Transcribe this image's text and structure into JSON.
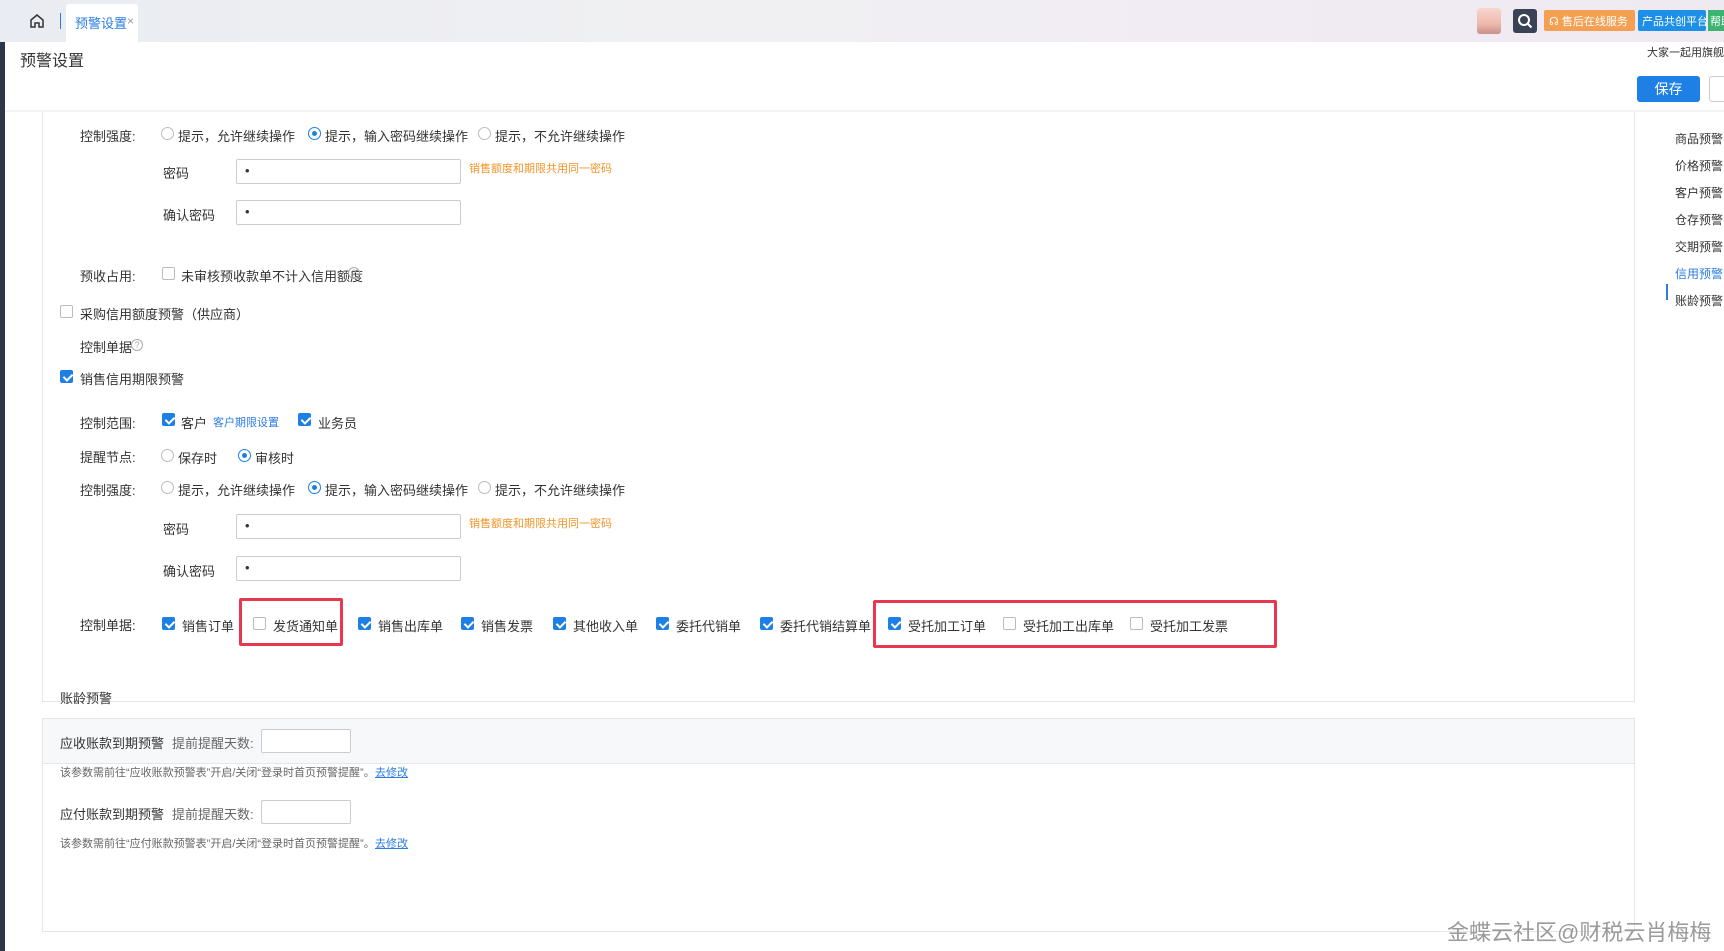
{
  "tabs": {
    "active_label": "预警设置",
    "close_glyph": "×"
  },
  "topbar": {
    "after_sales": "售后在线服务",
    "product_platform": "产品共创平台",
    "help": "帮助",
    "announcement": "大家一起用旗舰"
  },
  "page": {
    "title": "预警设置",
    "save_label": "保存"
  },
  "credit_section": {
    "strength_label": "控制强度:",
    "strength_options": [
      "提示，允许继续操作",
      "提示，输入密码继续操作",
      "提示，不允许继续操作"
    ],
    "password_label": "密码",
    "password_value": "•",
    "confirm_label": "确认密码",
    "confirm_value": "•",
    "shared_hint": "销售额度和期限共用同一密码",
    "prepay_label": "预收占用:",
    "prepay_option": "未审核预收款单不计入信用额度",
    "purchase_credit": "采购信用额度预警（供应商）",
    "control_docs_label": "控制单据",
    "sales_term": "销售信用期限预警",
    "scope_label": "控制范围:",
    "scope_customer": "客户",
    "scope_customer_link": "客户期限设置",
    "scope_salesman": "业务员",
    "remind_label": "提醒节点:",
    "remind_options": [
      "保存时",
      "审核时"
    ],
    "docs_label": "控制单据:",
    "docs": [
      {
        "label": "销售订单",
        "checked": true
      },
      {
        "label": "发货通知单",
        "checked": false
      },
      {
        "label": "销售出库单",
        "checked": true
      },
      {
        "label": "销售发票",
        "checked": true
      },
      {
        "label": "其他收入单",
        "checked": true
      },
      {
        "label": "委托代销单",
        "checked": true
      },
      {
        "label": "委托代销结算单",
        "checked": true
      },
      {
        "label": "受托加工订单",
        "checked": true
      },
      {
        "label": "受托加工出库单",
        "checked": false
      },
      {
        "label": "受托加工发票",
        "checked": false
      }
    ]
  },
  "aging_section": {
    "title": "账龄预警",
    "receivable_label": "应收账款到期预警",
    "remind_days_label": "提前提醒天数:",
    "receivable_note": "该参数需前往“应收账款预警表”开启/关闭“登录时首页预警提醒”。",
    "payable_label": "应付账款到期预警",
    "payable_note": "该参数需前往“应付账款预警表”开启/关闭“登录时首页预警提醒”。",
    "go_modify": "去修改"
  },
  "right_nav": [
    "商品预警",
    "价格预警",
    "客户预警",
    "仓存预警",
    "交期预警",
    "信用预警",
    "账龄预警"
  ],
  "watermark": "金蝶云社区@财税云肖梅梅",
  "colors": {
    "accent": "#1e7fe4",
    "highlight_box": "#e8384f",
    "hint": "#f29427"
  }
}
